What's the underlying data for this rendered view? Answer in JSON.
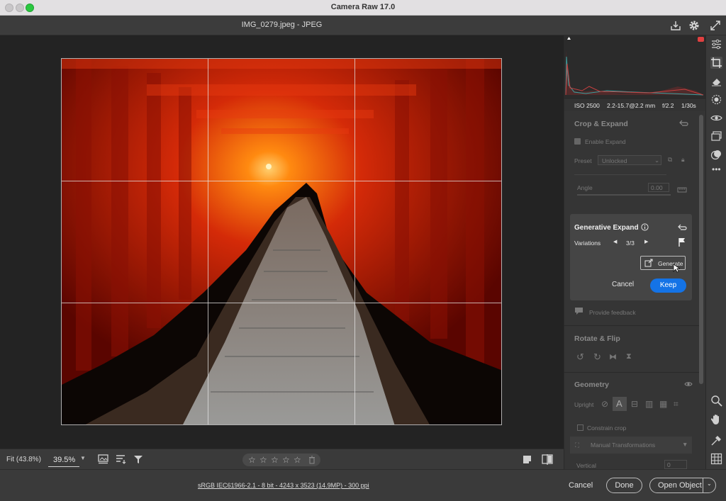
{
  "window": {
    "title": "Camera Raw 17.0"
  },
  "document": {
    "title": "IMG_0279.jpeg  -  JPEG"
  },
  "histogram": {
    "exif": {
      "iso": "ISO 2500",
      "lens": "2.2-15.7@2.2 mm",
      "aperture": "f/2.2",
      "shutter": "1/30s"
    }
  },
  "crop": {
    "title": "Crop & Expand",
    "enable_expand": "Enable Expand",
    "preset_label": "Preset",
    "preset_value": "Unlocked",
    "angle_label": "Angle",
    "angle_value": "0.00"
  },
  "generative_expand": {
    "title": "Generative Expand",
    "variations_label": "Variations",
    "variations_value": "3/3",
    "generate_label": "Generate",
    "cancel_label": "Cancel",
    "keep_label": "Keep",
    "feedback_label": "Provide feedback"
  },
  "rotate_flip": {
    "title": "Rotate & Flip"
  },
  "geometry": {
    "title": "Geometry",
    "upright_label": "Upright",
    "constrain_label": "Constrain crop",
    "manual_label": "Manual Transformations",
    "vertical_label": "Vertical",
    "vertical_value": "0"
  },
  "bottombar": {
    "fit_label": "Fit (43.8%)",
    "zoom_value": "39.5%"
  },
  "statusbar": {
    "info_link": "sRGB IEC61966-2.1 - 8 bit - 4243 x 3523 (14.9MP) - 300 ppi",
    "cancel_label": "Cancel",
    "done_label": "Done",
    "open_label": "Open Object"
  },
  "colors": {
    "accent": "#1473e6",
    "torii_red": "#c41a08"
  }
}
